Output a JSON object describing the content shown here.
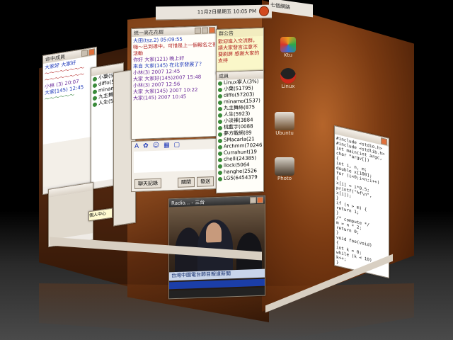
{
  "screen": {
    "clock": "11月2日星期五 10:05 PM",
    "right_panel_label": "七個網路",
    "accent": "#c0602a"
  },
  "chat_window": {
    "title": "統一高花花樹",
    "lines": [
      {
        "text": "大田(tsz.2) 05:09:55",
        "color": "blue"
      },
      {
        "text": "嗨～已到達中，可惜是上一個報名之後的",
        "color": "red"
      },
      {
        "text": "活動",
        "color": "red"
      },
      {
        "text": "你好 大家(121) 晚上好",
        "color": "purple"
      },
      {
        "text": "來自 大家(145) 在北京發展了？",
        "color": "blue"
      },
      {
        "text": "小林(3) 2007 12:45",
        "color": "purple"
      },
      {
        "text": "大家 大家好(145)2007 15:48",
        "color": "purple"
      },
      {
        "text": "小林(3) 2007 12:56",
        "color": "purple"
      },
      {
        "text": "大家 大家(145) 2007 10:22",
        "color": "purple"
      },
      {
        "text": "大家(145) 2007 10:45",
        "color": "purple"
      }
    ],
    "toolbar_icons": [
      "A",
      "✿",
      "☺",
      "▦",
      "▢"
    ],
    "left_button": "聊天記錄",
    "send_button": "發送",
    "close_button": "關閉"
  },
  "notice": {
    "title": "群公告",
    "text": "歡迎進入交流群，請大家發言注意不要刷屏 感謝大家的支持"
  },
  "members": {
    "title": "成員",
    "items": [
      "Linux寧人(3%)",
      "小葉(51795)",
      "diffo(57203)",
      "minamo(1537)",
      "九主舞絲(875",
      "人生(5923)",
      "小淡裸(3884",
      "桃藍宇(0088",
      "夢方戰網(89",
      "SMacarla(21",
      "Archmm(70246",
      "Currahunt(19",
      "chelli(24385)",
      "llock(5064",
      "hanghe(2526",
      "LGS(6454379"
    ]
  },
  "left_face": {
    "title": "命中成員",
    "lines": [
      {
        "text": "大家好 大家好",
        "color": "blue"
      },
      {
        "text": "～～～～～～～～",
        "color": "red"
      },
      {
        "text": "～～～～～～～～",
        "color": "red"
      },
      {
        "text": "小林 (3) 20:07",
        "color": "purple"
      },
      {
        "text": "大家(145) 12:45",
        "color": "blue"
      },
      {
        "text": "～～～～～～",
        "color": "green"
      }
    ],
    "tooltip": "個人中心"
  },
  "video": {
    "title": "Radio... - 三台",
    "caption": "台灣中國電台節目報道新聞"
  },
  "desktop_icons": [
    {
      "label": "Ktu",
      "color": "#e9a020"
    },
    {
      "label": "Linux",
      "color": "#cc2a1a"
    },
    {
      "label": "Ubuntu",
      "color": "#8a5a2a"
    },
    {
      "label": "Photo",
      "color": "#5a4a3a"
    }
  ],
  "text_editor": {
    "lines": [
      "#include <stdio.h>",
      "#include <stdlib.h>",
      "int main(int argc,",
      "  char *argv[])",
      "{",
      "  int i, n, m;",
      "  double x[100];",
      "  for (i=0;i<n;i++)",
      "  {",
      "    x[i] = i*0.5;",
      "    printf(\"%f\\n\",",
      "      x[i]);",
      "  }",
      "  if (n > m) {",
      "    return 1;",
      "  }",
      "  /* compute */",
      "  m = n * 2;",
      "  return 0;",
      "}",
      "void foo(void)",
      "{",
      "  int k = 0;",
      "  while (k < 10)",
      "    k++;",
      "}"
    ]
  }
}
